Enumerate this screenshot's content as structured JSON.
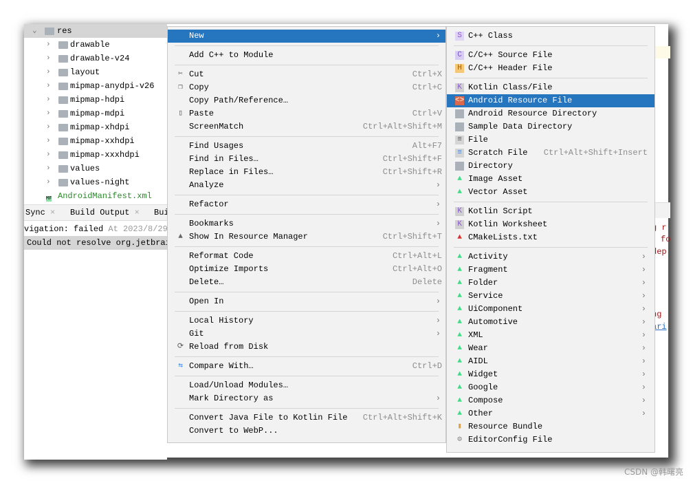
{
  "tree": {
    "root": "res",
    "items": [
      "drawable",
      "drawable-v24",
      "layout",
      "mipmap-anydpi-v26",
      "mipmap-hdpi",
      "mipmap-mdpi",
      "mipmap-xhdpi",
      "mipmap-xxhdpi",
      "mipmap-xxxhdpi",
      "values",
      "values-night"
    ],
    "manifest": "AndroidManifest.xml"
  },
  "bottom": {
    "tabs": [
      "Sync",
      "Build Output",
      "Bui"
    ],
    "line1_label": "vigation: failed",
    "line1_time": "At 2023/8/29",
    "line2": "Could not resolve org.jetbrai"
  },
  "editor_fragments": [
    "g r",
    "fo",
    "dep",
    "ng",
    "ari"
  ],
  "context_menu": {
    "groups": [
      [
        {
          "label": "New",
          "arrow": true,
          "selected": true
        }
      ],
      [
        {
          "label": "Add C++ to Module"
        }
      ],
      [
        {
          "label": "Cut",
          "shortcut": "Ctrl+X",
          "icon": "scissors-icon"
        },
        {
          "label": "Copy",
          "shortcut": "Ctrl+C",
          "icon": "copy-icon"
        },
        {
          "label": "Copy Path/Reference…"
        },
        {
          "label": "Paste",
          "shortcut": "Ctrl+V",
          "icon": "clipboard-icon"
        },
        {
          "label": "ScreenMatch",
          "shortcut": "Ctrl+Alt+Shift+M"
        }
      ],
      [
        {
          "label": "Find Usages",
          "shortcut": "Alt+F7"
        },
        {
          "label": "Find in Files…",
          "shortcut": "Ctrl+Shift+F"
        },
        {
          "label": "Replace in Files…",
          "shortcut": "Ctrl+Shift+R"
        },
        {
          "label": "Analyze",
          "arrow": true
        }
      ],
      [
        {
          "label": "Refactor",
          "arrow": true
        }
      ],
      [
        {
          "label": "Bookmarks",
          "arrow": true
        },
        {
          "label": "Show In Resource Manager",
          "shortcut": "Ctrl+Shift+T",
          "icon": "resource-manager-icon"
        }
      ],
      [
        {
          "label": "Reformat Code",
          "shortcut": "Ctrl+Alt+L"
        },
        {
          "label": "Optimize Imports",
          "shortcut": "Ctrl+Alt+O"
        },
        {
          "label": "Delete…",
          "shortcut": "Delete"
        }
      ],
      [
        {
          "label": "Open In",
          "arrow": true
        }
      ],
      [
        {
          "label": "Local History",
          "arrow": true
        },
        {
          "label": "Git",
          "arrow": true
        },
        {
          "label": "Reload from Disk",
          "icon": "reload-icon"
        }
      ],
      [
        {
          "label": "Compare With…",
          "shortcut": "Ctrl+D",
          "icon": "compare-icon"
        }
      ],
      [
        {
          "label": "Load/Unload Modules…"
        },
        {
          "label": "Mark Directory as",
          "arrow": true
        }
      ],
      [
        {
          "label": "Convert Java File to Kotlin File",
          "shortcut": "Ctrl+Alt+Shift+K"
        },
        {
          "label": "Convert to WebP..."
        }
      ]
    ]
  },
  "new_submenu": {
    "groups": [
      [
        {
          "label": "C++ Class",
          "icon": "cpp-class-icon"
        }
      ],
      [
        {
          "label": "C/C++ Source File",
          "icon": "cpp-source-icon"
        },
        {
          "label": "C/C++ Header File",
          "icon": "cpp-header-icon"
        }
      ],
      [
        {
          "label": "Kotlin Class/File",
          "icon": "kotlin-file-icon"
        },
        {
          "label": "Android Resource File",
          "icon": "resource-file-icon",
          "selected": true
        },
        {
          "label": "Android Resource Directory",
          "icon": "folder-icon"
        },
        {
          "label": "Sample Data Directory",
          "icon": "folder-icon"
        },
        {
          "label": "File",
          "icon": "file-icon"
        },
        {
          "label": "Scratch File",
          "shortcut": "Ctrl+Alt+Shift+Insert",
          "icon": "scratch-file-icon"
        },
        {
          "label": "Directory",
          "icon": "folder-icon"
        },
        {
          "label": "Image Asset",
          "icon": "android-icon"
        },
        {
          "label": "Vector Asset",
          "icon": "android-icon"
        }
      ],
      [
        {
          "label": "Kotlin Script",
          "icon": "kotlin-file-icon"
        },
        {
          "label": "Kotlin Worksheet",
          "icon": "kotlin-file-icon"
        },
        {
          "label": "CMakeLists.txt",
          "icon": "cmake-icon"
        }
      ],
      [
        {
          "label": "Activity",
          "icon": "android-icon",
          "arrow": true
        },
        {
          "label": "Fragment",
          "icon": "android-icon",
          "arrow": true
        },
        {
          "label": "Folder",
          "icon": "android-icon",
          "arrow": true
        },
        {
          "label": "Service",
          "icon": "android-icon",
          "arrow": true
        },
        {
          "label": "UiComponent",
          "icon": "android-icon",
          "arrow": true
        },
        {
          "label": "Automotive",
          "icon": "android-icon",
          "arrow": true
        },
        {
          "label": "XML",
          "icon": "android-icon",
          "arrow": true
        },
        {
          "label": "Wear",
          "icon": "android-icon",
          "arrow": true
        },
        {
          "label": "AIDL",
          "icon": "android-icon",
          "arrow": true
        },
        {
          "label": "Widget",
          "icon": "android-icon",
          "arrow": true
        },
        {
          "label": "Google",
          "icon": "android-icon",
          "arrow": true
        },
        {
          "label": "Compose",
          "icon": "android-icon",
          "arrow": true
        },
        {
          "label": "Other",
          "icon": "android-icon",
          "arrow": true
        },
        {
          "label": "Resource Bundle",
          "icon": "resource-bundle-icon"
        },
        {
          "label": "EditorConfig File",
          "icon": "gear-icon"
        }
      ]
    ]
  },
  "watermark": "CSDN @韩曙亮",
  "colors": {
    "selection": "#2675bf",
    "menu_bg": "#f2f2f2",
    "android_green": "#3ddc84"
  }
}
